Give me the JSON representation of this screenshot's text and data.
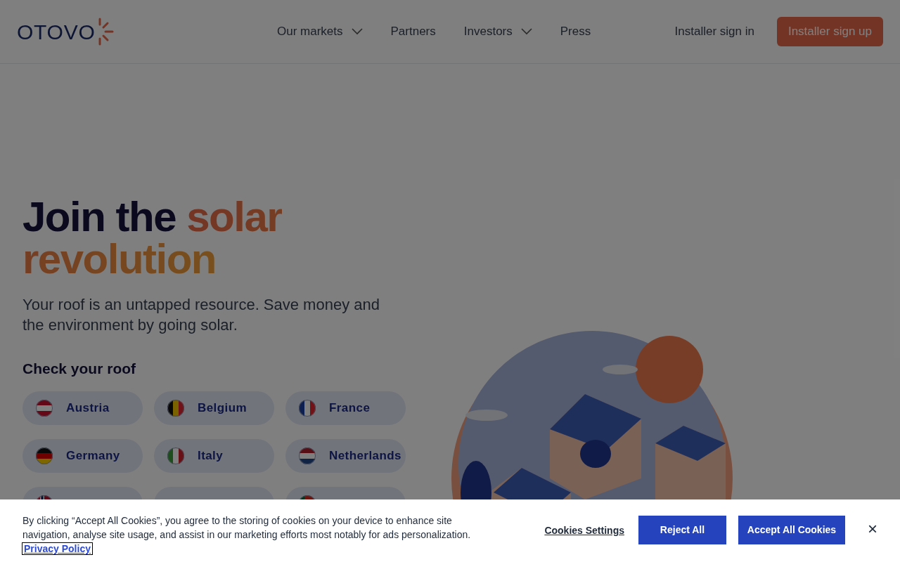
{
  "header": {
    "logo": "OTOVO",
    "nav": [
      {
        "label": "Our markets",
        "kind": "dropdown"
      },
      {
        "label": "Partners",
        "kind": "link"
      },
      {
        "label": "Investors",
        "kind": "dropdown"
      },
      {
        "label": "Press",
        "kind": "link"
      }
    ],
    "sign_in": "Installer sign in",
    "sign_up": "Installer sign up"
  },
  "hero": {
    "title_plain": "Join the",
    "title_highlight": "solar revolution",
    "subtitle": "Your roof is an untapped resource. Save money and the environment by going solar.",
    "check_label": "Check your roof",
    "countries": [
      {
        "label": "Austria",
        "kind": "at"
      },
      {
        "label": "Belgium",
        "kind": "be"
      },
      {
        "label": "France",
        "kind": "fr"
      },
      {
        "label": "Germany",
        "kind": "de"
      },
      {
        "label": "Italy",
        "kind": "it"
      },
      {
        "label": "Netherlands",
        "kind": "nl"
      },
      {
        "kind": "no"
      },
      {
        "kind": "blank"
      },
      {
        "kind": "pt"
      }
    ]
  },
  "cookie_banner": {
    "text": "By clicking “Accept All Cookies”, you agree to the storing of cookies on your device to enhance site navigation, analyse site usage, and assist in our marketing efforts most notably for ads personalization.",
    "privacy_link": "Privacy Policy",
    "settings": "Cookies Settings",
    "reject": "Reject All",
    "accept": "Accept All Cookies",
    "close": "×"
  }
}
